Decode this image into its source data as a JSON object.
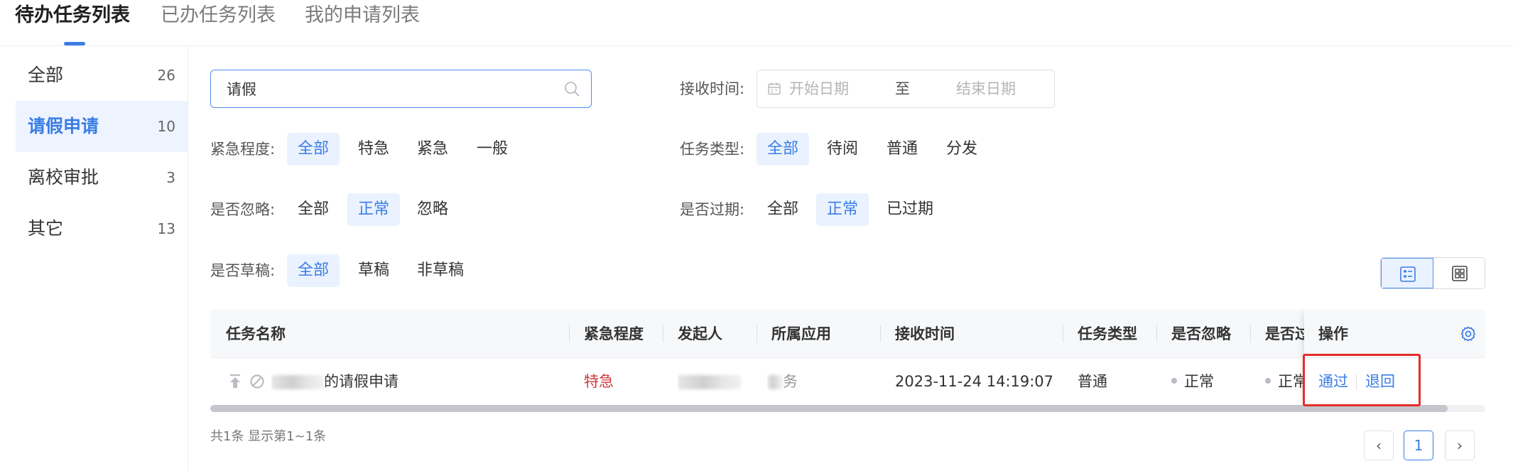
{
  "tabs": [
    {
      "label": "待办任务列表",
      "active": true
    },
    {
      "label": "已办任务列表",
      "active": false
    },
    {
      "label": "我的申请列表",
      "active": false
    }
  ],
  "sidebar": {
    "items": [
      {
        "label": "全部",
        "count": "26",
        "active": false
      },
      {
        "label": "请假申请",
        "count": "10",
        "active": true
      },
      {
        "label": "离校审批",
        "count": "3",
        "active": false
      },
      {
        "label": "其它",
        "count": "13",
        "active": false
      }
    ]
  },
  "search": {
    "value": "请假",
    "placeholder": ""
  },
  "filters": {
    "receive_time_label": "接收时间:",
    "start_date_placeholder": "开始日期",
    "date_separator": "至",
    "end_date_placeholder": "结束日期",
    "urgency": {
      "label": "紧急程度:",
      "options": [
        "全部",
        "特急",
        "紧急",
        "一般"
      ],
      "selected": "全部"
    },
    "task_type": {
      "label": "任务类型:",
      "options": [
        "全部",
        "待阅",
        "普通",
        "分发"
      ],
      "selected": "全部"
    },
    "ignored": {
      "label": "是否忽略:",
      "options": [
        "全部",
        "正常",
        "忽略"
      ],
      "selected": "正常"
    },
    "expired": {
      "label": "是否过期:",
      "options": [
        "全部",
        "正常",
        "已过期"
      ],
      "selected": "正常"
    },
    "draft": {
      "label": "是否草稿:",
      "options": [
        "全部",
        "草稿",
        "非草稿"
      ],
      "selected": "全部"
    }
  },
  "table": {
    "columns": [
      "任务名称",
      "紧急程度",
      "发起人",
      "所属应用",
      "接收时间",
      "任务类型",
      "是否忽略",
      "是否过期",
      "操作"
    ],
    "rows": [
      {
        "name_suffix": "的请假申请",
        "urgency": "特急",
        "app_suffix": "务",
        "receive_time": "2023-11-24 14:19:07",
        "task_type": "普通",
        "ignored": "正常",
        "expired": "正常",
        "actions": [
          "通过",
          "退回"
        ]
      }
    ]
  },
  "footer": {
    "summary": "共1条 显示第1~1条",
    "pager": {
      "prev": "‹",
      "current": "1",
      "next": "›"
    }
  },
  "colors": {
    "accent": "#3a7de6",
    "urgent": "#d03b3b",
    "highlight": "#e52c2c"
  }
}
